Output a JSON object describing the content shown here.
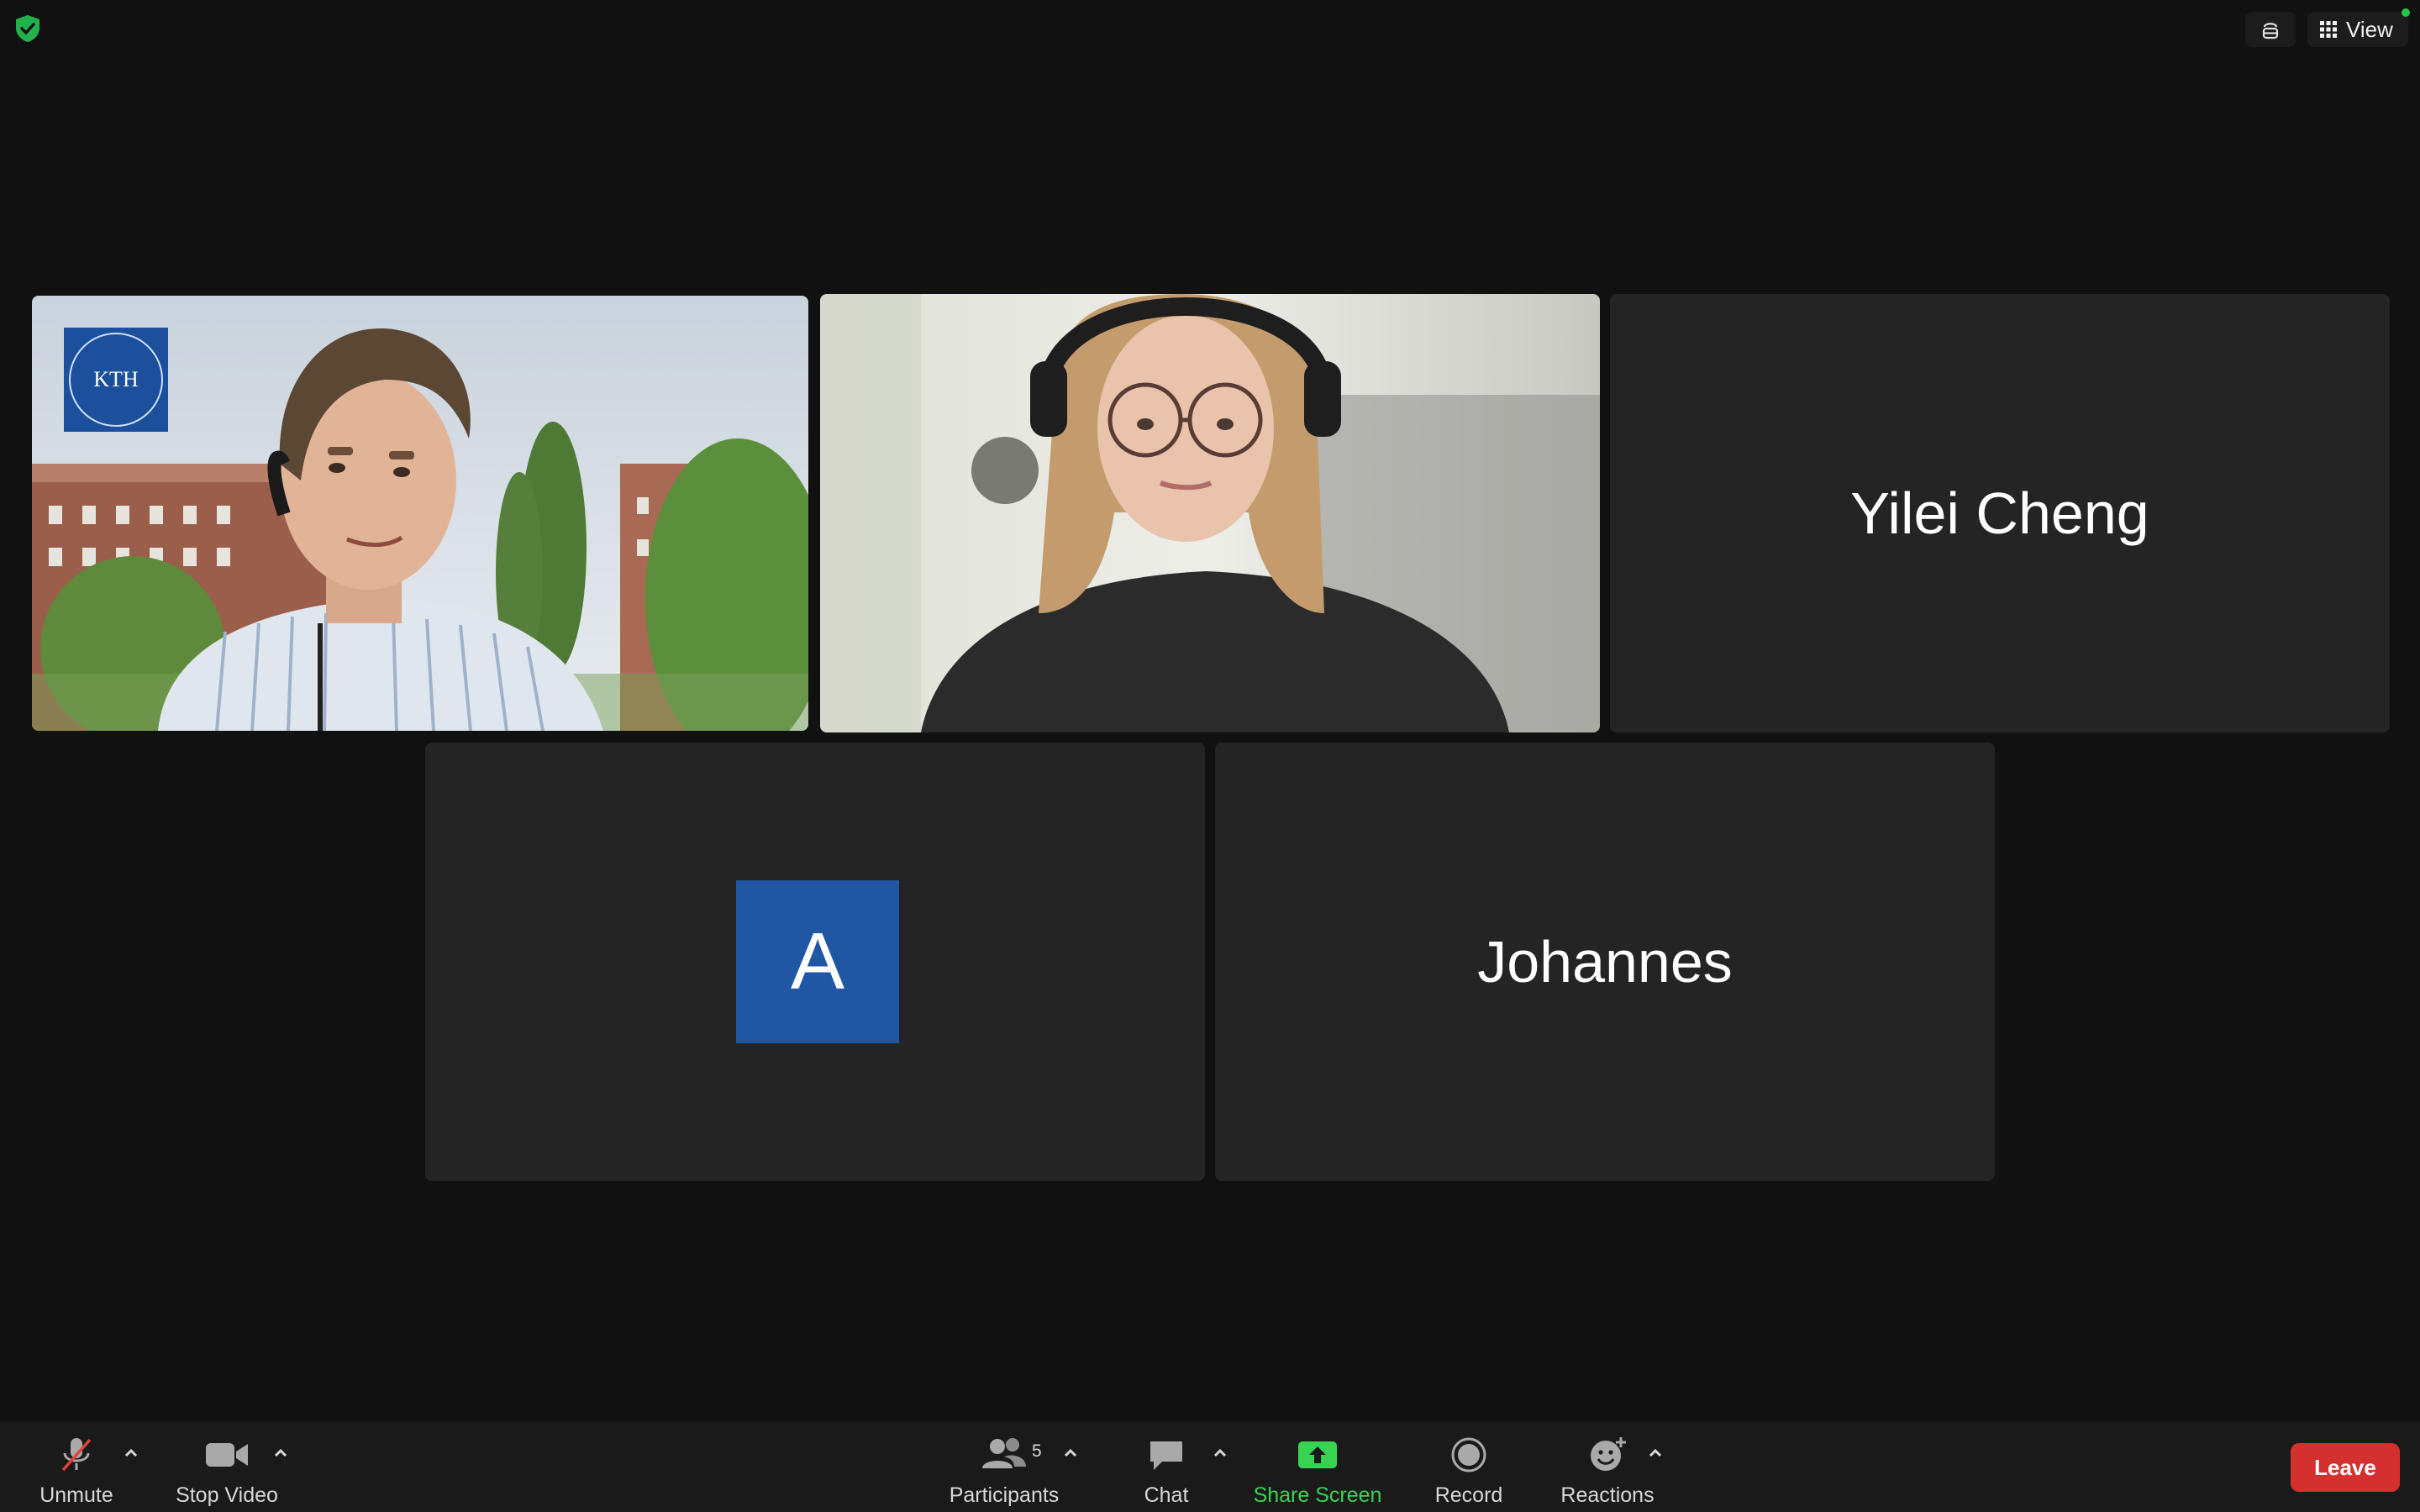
{
  "top_bar": {
    "view_label": "View"
  },
  "tiles": {
    "tile3_name": "Yilei Cheng",
    "tile4_avatar_letter": "A",
    "tile5_name": "Johannes",
    "kth_logo_text": "KTH"
  },
  "toolbar": {
    "unmute": "Unmute",
    "stop_video": "Stop Video",
    "participants": "Participants",
    "participants_count": "5",
    "chat": "Chat",
    "share_screen": "Share Screen",
    "record": "Record",
    "reactions": "Reactions",
    "leave": "Leave"
  },
  "colors": {
    "active_speaker_border": "#2fd157",
    "leave_button": "#d3302f",
    "share_screen_accent": "#39d353",
    "avatar_bg": "#1f57a4"
  }
}
